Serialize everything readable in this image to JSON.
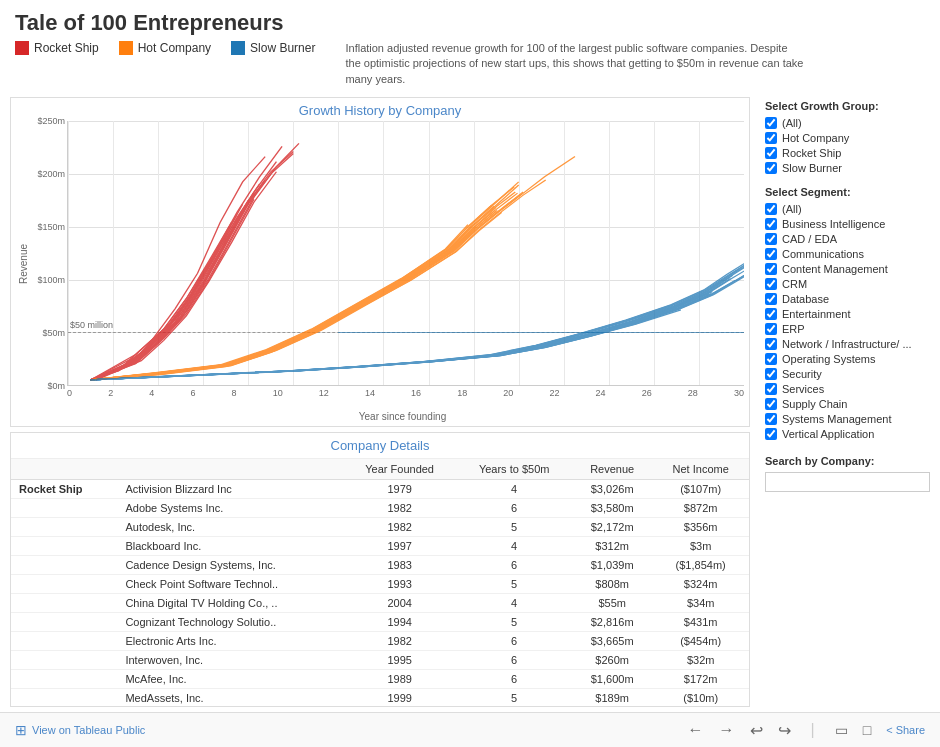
{
  "title": "Tale of 100 Entrepreneurs",
  "description": "Inflation adjusted revenue growth for 100 of the largest public software companies. Despite the optimistic projections of new start ups, this shows that getting to $50m in revenue can take many years.",
  "legend": [
    {
      "label": "Rocket Ship",
      "color": "#d62728",
      "id": "rocket-ship"
    },
    {
      "label": "Hot Company",
      "color": "#ff7f0e",
      "id": "hot-company"
    },
    {
      "label": "Slow Burner",
      "color": "#1f77b4",
      "id": "slow-burner"
    }
  ],
  "chart": {
    "title": "Growth History by Company",
    "y_axis_label": "Revenue",
    "x_axis_label": "Year since founding",
    "y_labels": [
      "$250m",
      "$200m",
      "$150m",
      "$100m",
      "$50m",
      "$0m"
    ],
    "x_labels": [
      "0",
      "2",
      "4",
      "6",
      "8",
      "10",
      "12",
      "14",
      "16",
      "18",
      "20",
      "22",
      "24",
      "26",
      "28",
      "30"
    ],
    "fifty_m_label": "$50 million"
  },
  "filter": {
    "growth_group_title": "Select Growth Group:",
    "growth_groups": [
      {
        "label": "(All)",
        "checked": true
      },
      {
        "label": "Hot Company",
        "checked": true
      },
      {
        "label": "Rocket Ship",
        "checked": true
      },
      {
        "label": "Slow Burner",
        "checked": true
      }
    ],
    "segment_title": "Select Segment:",
    "segments": [
      {
        "label": "(All)",
        "checked": true
      },
      {
        "label": "Business Intelligence",
        "checked": true
      },
      {
        "label": "CAD / EDA",
        "checked": true
      },
      {
        "label": "Communications",
        "checked": true
      },
      {
        "label": "Content Management",
        "checked": true
      },
      {
        "label": "CRM",
        "checked": true
      },
      {
        "label": "Database",
        "checked": true
      },
      {
        "label": "Entertainment",
        "checked": true
      },
      {
        "label": "ERP",
        "checked": true
      },
      {
        "label": "Network / Infrastructure/ ...",
        "checked": true
      },
      {
        "label": "Operating Systems",
        "checked": true
      },
      {
        "label": "Security",
        "checked": true
      },
      {
        "label": "Services",
        "checked": true
      },
      {
        "label": "Supply Chain",
        "checked": true
      },
      {
        "label": "Systems Management",
        "checked": true
      },
      {
        "label": "Vertical Application",
        "checked": true
      }
    ],
    "search_title": "Search by Company:",
    "search_placeholder": ""
  },
  "table": {
    "title": "Company Details",
    "columns": [
      "",
      "Year Founded",
      "Years to $50m",
      "Revenue",
      "Net Income"
    ],
    "rows": [
      {
        "group": "Rocket Ship",
        "company": "Activision Blizzard Inc",
        "year_founded": "1979",
        "years_to_50m": "4",
        "revenue": "$3,026m",
        "net_income": "($107m)"
      },
      {
        "group": "",
        "company": "Adobe Systems Inc.",
        "year_founded": "1982",
        "years_to_50m": "6",
        "revenue": "$3,580m",
        "net_income": "$872m"
      },
      {
        "group": "",
        "company": "Autodesk, Inc.",
        "year_founded": "1982",
        "years_to_50m": "5",
        "revenue": "$2,172m",
        "net_income": "$356m"
      },
      {
        "group": "",
        "company": "Blackboard Inc.",
        "year_founded": "1997",
        "years_to_50m": "4",
        "revenue": "$312m",
        "net_income": "$3m"
      },
      {
        "group": "",
        "company": "Cadence Design Systems, Inc.",
        "year_founded": "1983",
        "years_to_50m": "6",
        "revenue": "$1,039m",
        "net_income": "($1,854m)"
      },
      {
        "group": "",
        "company": "Check Point Software Technol..",
        "year_founded": "1993",
        "years_to_50m": "5",
        "revenue": "$808m",
        "net_income": "$324m"
      },
      {
        "group": "",
        "company": "China Digital TV Holding Co., ..",
        "year_founded": "2004",
        "years_to_50m": "4",
        "revenue": "$55m",
        "net_income": "$34m"
      },
      {
        "group": "",
        "company": "Cognizant Technology Solutio..",
        "year_founded": "1994",
        "years_to_50m": "5",
        "revenue": "$2,816m",
        "net_income": "$431m"
      },
      {
        "group": "",
        "company": "Electronic Arts Inc.",
        "year_founded": "1982",
        "years_to_50m": "6",
        "revenue": "$3,665m",
        "net_income": "($454m)"
      },
      {
        "group": "",
        "company": "Interwoven, Inc.",
        "year_founded": "1995",
        "years_to_50m": "6",
        "revenue": "$260m",
        "net_income": "$32m"
      },
      {
        "group": "",
        "company": "McAfee, Inc.",
        "year_founded": "1989",
        "years_to_50m": "6",
        "revenue": "$1,600m",
        "net_income": "$172m"
      },
      {
        "group": "",
        "company": "MedAssets, Inc.",
        "year_founded": "1999",
        "years_to_50m": "5",
        "revenue": "$189m",
        "net_income": "($10m)"
      }
    ]
  },
  "footer": {
    "tableau_label": "View on Tableau Public",
    "buttons": [
      "⟵",
      "⟶",
      "↩",
      "↪"
    ]
  }
}
